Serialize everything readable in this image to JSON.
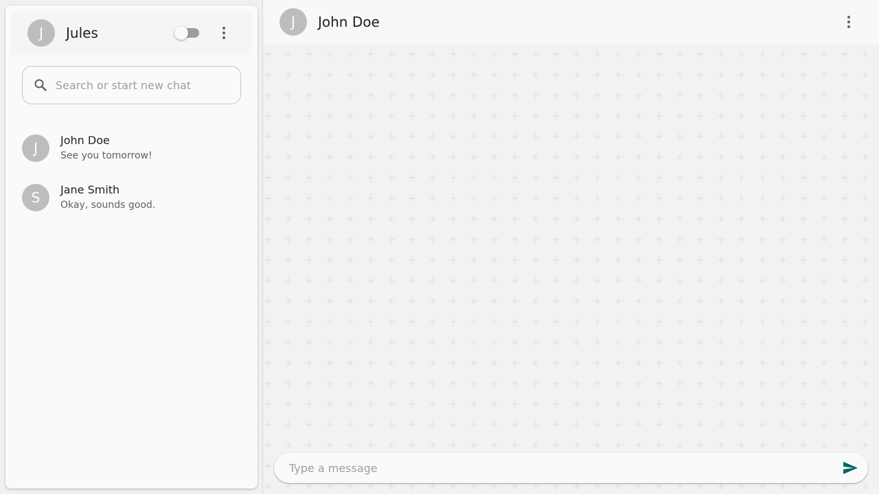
{
  "sidebar": {
    "user": {
      "avatar_letter": "J",
      "name": "Jules"
    },
    "theme_toggle": {
      "on": false
    },
    "menu_icon": "more-vert-icon",
    "search": {
      "placeholder": "Search or start new chat",
      "value": "",
      "icon": "search-icon"
    },
    "chats": [
      {
        "avatar_letter": "J",
        "name": "John Doe",
        "preview": "See you tomorrow!"
      },
      {
        "avatar_letter": "S",
        "name": "Jane Smith",
        "preview": "Okay, sounds good."
      }
    ]
  },
  "conversation": {
    "contact": {
      "avatar_letter": "J",
      "name": "John Doe"
    },
    "menu_icon": "more-vert-icon",
    "composer": {
      "placeholder": "Type a message",
      "value": "",
      "send_icon": "send-icon"
    }
  },
  "colors": {
    "accent": "#00695c",
    "avatar_bg": "#bdbdbd",
    "chat_background": "#f2f2f2"
  }
}
